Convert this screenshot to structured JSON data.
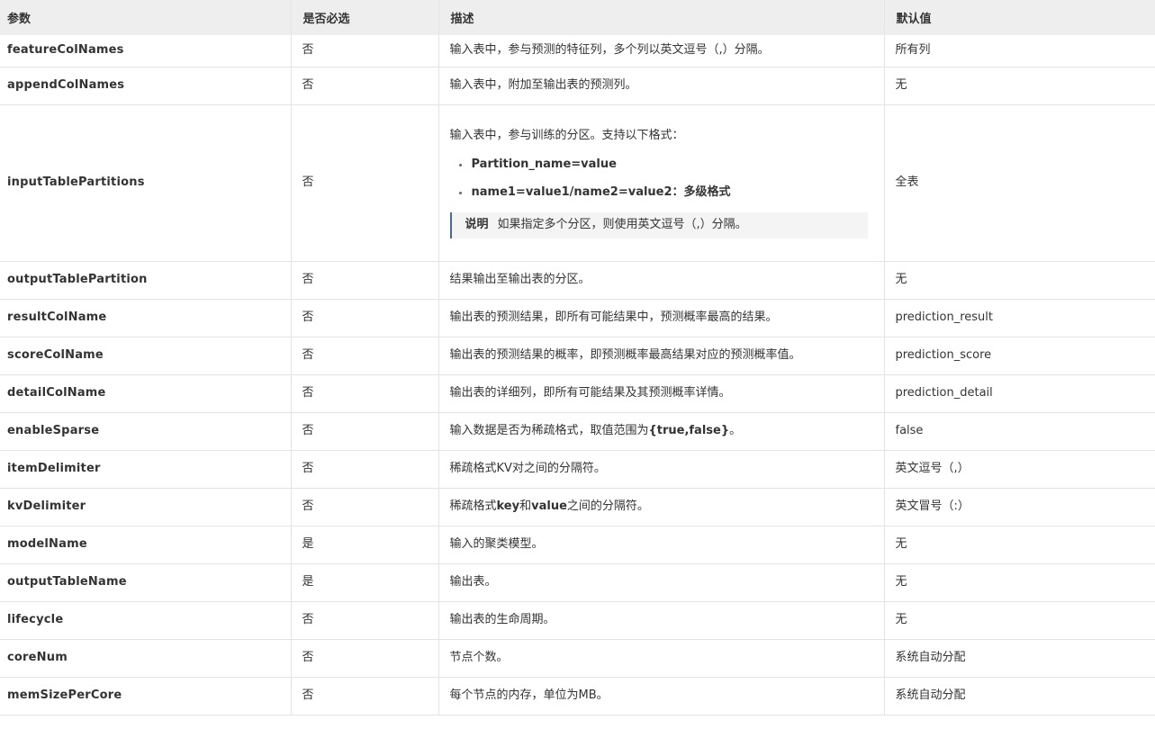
{
  "header": {
    "col_param": "参数",
    "col_required": "是否必选",
    "col_desc": "描述",
    "col_default": "默认值"
  },
  "rows": [
    {
      "param": "featureColNames",
      "required": "否",
      "desc": "输入表中，参与预测的特征列，多个列以英文逗号（,）分隔。",
      "default": "所有列"
    },
    {
      "param": "appendColNames",
      "required": "否",
      "desc": "输入表中，附加至输出表的预测列。",
      "default": "无"
    },
    {
      "param": "inputTablePartitions",
      "required": "否",
      "desc": "输入表中，参与训练的分区。支持以下格式：",
      "formats": [
        "Partition_name=value",
        "name1=value1/name2=value2：多级格式"
      ],
      "note_label": "说明",
      "note_text": "如果指定多个分区，则使用英文逗号（,）分隔。",
      "default": "全表"
    },
    {
      "param": "outputTablePartition",
      "required": "否",
      "desc": "结果输出至输出表的分区。",
      "default": "无"
    },
    {
      "param": "resultColName",
      "required": "否",
      "desc": "输出表的预测结果，即所有可能结果中，预测概率最高的结果。",
      "default": "prediction_result"
    },
    {
      "param": "scoreColName",
      "required": "否",
      "desc": "输出表的预测结果的概率，即预测概率最高结果对应的预测概率值。",
      "default": "prediction_score"
    },
    {
      "param": "detailColName",
      "required": "否",
      "desc": "输出表的详细列，即所有可能结果及其预测概率详情。",
      "default": "prediction_detail"
    },
    {
      "param": "enableSparse",
      "required": "否",
      "desc_pre": "输入数据是否为稀疏格式，取值范围为",
      "desc_bold": "{true,false}",
      "desc_post": "。",
      "default": "false"
    },
    {
      "param": "itemDelimiter",
      "required": "否",
      "desc": "稀疏格式KV对之间的分隔符。",
      "default": "英文逗号（,）"
    },
    {
      "param": "kvDelimiter",
      "required": "否",
      "desc_pre": "稀疏格式",
      "desc_bold": "key",
      "desc_mid": "和",
      "desc_bold2": "value",
      "desc_post": "之间的分隔符。",
      "default": "英文冒号（:）"
    },
    {
      "param": "modelName",
      "required": "是",
      "desc": "输入的聚类模型。",
      "default": "无"
    },
    {
      "param": "outputTableName",
      "required": "是",
      "desc": "输出表。",
      "default": "无"
    },
    {
      "param": "lifecycle",
      "required": "否",
      "desc": "输出表的生命周期。",
      "default": "无"
    },
    {
      "param": "coreNum",
      "required": "否",
      "desc": "节点个数。",
      "default": "系统自动分配"
    },
    {
      "param": "memSizePerCore",
      "required": "否",
      "desc": "每个节点的内存，单位为MB。",
      "default": "系统自动分配"
    }
  ]
}
